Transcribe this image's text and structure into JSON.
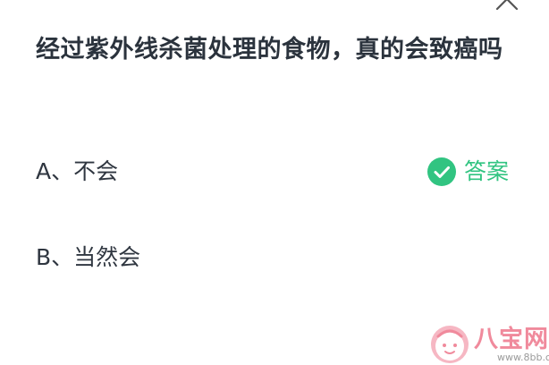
{
  "question": {
    "text": "经过紫外线杀菌处理的食物，真的会致癌吗"
  },
  "options": [
    {
      "label": "A、不会",
      "is_answer": true
    },
    {
      "label": "B、当然会",
      "is_answer": false
    }
  ],
  "answer_tag": {
    "label": "答案",
    "color": "#31c481"
  },
  "icons": {
    "close": "close-icon",
    "check": "check-circle-icon"
  },
  "watermark": {
    "brand": "八宝网",
    "url": "www.8bb.com"
  }
}
